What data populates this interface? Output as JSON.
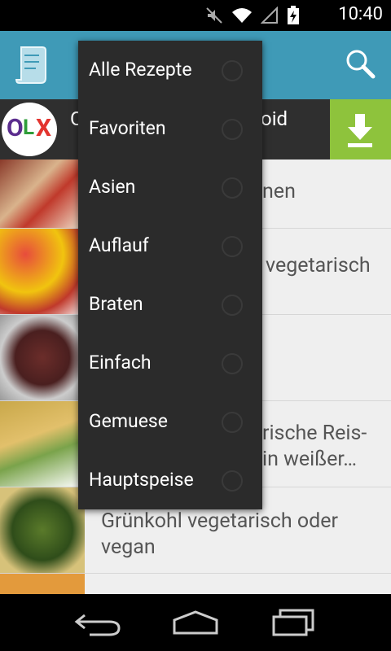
{
  "status_bar": {
    "time": "10:40"
  },
  "ad": {
    "logo_text": "OLX",
    "text_left": "O",
    "text_right": "oid"
  },
  "list": {
    "items": [
      {
        "title": "nen"
      },
      {
        "title": "vegetarisch"
      },
      {
        "title": ""
      },
      {
        "title_line1": "rische Reis-",
        "title_line2": "in weißer…"
      },
      {
        "title_line1": "Grünkohl vegetarisch oder",
        "title_line2": "vegan"
      }
    ]
  },
  "menu": {
    "items": [
      {
        "label": "Alle Rezepte"
      },
      {
        "label": "Favoriten"
      },
      {
        "label": "Asien"
      },
      {
        "label": "Auflauf"
      },
      {
        "label": "Braten"
      },
      {
        "label": "Einfach"
      },
      {
        "label": "Gemuese"
      },
      {
        "label": "Hauptspeise"
      }
    ]
  },
  "colors": {
    "action_bar": "#3f9ab7",
    "menu_bg": "#2b2b2b",
    "download": "#8ec33c"
  }
}
